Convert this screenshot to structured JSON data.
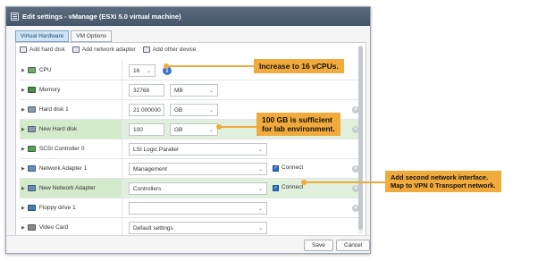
{
  "window": {
    "title": "Edit settings - vManage (ESXi 5.0 virtual machine)"
  },
  "tabs": [
    {
      "label": "Virtual Hardware"
    },
    {
      "label": "VM Options"
    }
  ],
  "actions": {
    "add_hard_disk": "Add hard disk",
    "add_network_adapter": "Add network adapter",
    "add_other_device": "Add other device"
  },
  "rows": {
    "cpu": {
      "label": "CPU",
      "value": "16"
    },
    "memory": {
      "label": "Memory",
      "value": "32768",
      "unit": "MB"
    },
    "hard_disk_1": {
      "label": "Hard disk 1",
      "value": "21 000000",
      "unit": "GB"
    },
    "new_hard_disk": {
      "label": "New Hard disk",
      "value": "100",
      "unit": "GB"
    },
    "scsi": {
      "label": "SCSI Controller 0",
      "value": "LSI Logic Parallel"
    },
    "net1": {
      "label": "Network Adapter 1",
      "value": "Management",
      "connect": "Connect"
    },
    "new_net": {
      "label": "New Network Adapter",
      "value": "Controllers",
      "connect": "Connect"
    },
    "floppy": {
      "label": "Floppy drive 1",
      "value": ""
    },
    "video": {
      "label": "Video Card",
      "value": "Default settings"
    }
  },
  "footer": {
    "save": "Save",
    "cancel": "Cancel"
  },
  "callouts": {
    "cpu": "Increase to 16 vCPUs.",
    "disk_line1": "100 GB is sufficient",
    "disk_line2": "for lab environment.",
    "net_line1": "Add second network interface.",
    "net_line2": "Map to VPN 0 Transport network."
  },
  "colors": {
    "callout": "#f0ab3c",
    "highlight_row": "#e1f0dc",
    "titlebar": "#4f5f72"
  }
}
